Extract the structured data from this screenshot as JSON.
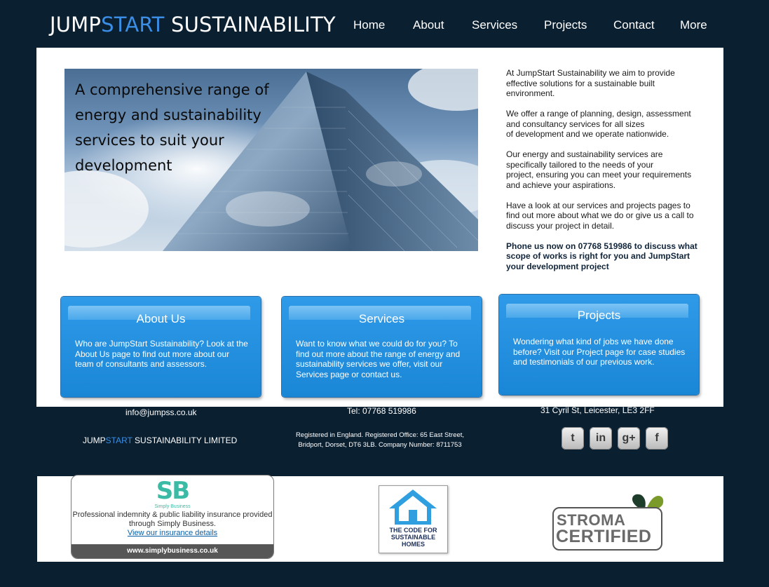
{
  "header": {
    "logo_part1": "JUMP",
    "logo_part2": "START",
    "logo_part3": " SUSTAINABILITY",
    "nav": [
      "Home",
      "About",
      "Services",
      "Projects",
      "Contact",
      "More"
    ]
  },
  "hero": {
    "headline": "A comprehensive range of energy and sustainability services to suit your development"
  },
  "intro": {
    "paragraphs": [
      "At JumpStart Sustainability we aim to provide\neffective solutions for a sustainable built\nenvironment.",
      "We offer a range of planning, design, assessment\nand consultancy services for all sizes\nof development and we operate nationwide.",
      "Our energy and sustainability services are\nspecifically tailored to the needs of your\nproject, ensuring you can meet your requirements\nand achieve your aspirations.",
      "Have a look at our services and projects pages to\nfind out more about what we do or give us a call to\ndiscuss your project in detail."
    ],
    "callout": "Phone us now on 07768 519986  to discuss what\nscope of works is right for you and JumpStart\nyour development project"
  },
  "cards": [
    {
      "title": "About Us",
      "body": "Who are JumpStart Sustainability? Look at the About Us page to find out more about our team of consultants and assessors."
    },
    {
      "title": "Services",
      "body": "Want to know what we could do for you? To find out more about the range of energy and sustainability services we offer, visit our Services page or contact us."
    },
    {
      "title": "Projects",
      "body": "Wondering what kind of jobs we have done before? Visit our Project page for case studies and testimonials of our previous work."
    }
  ],
  "footer": {
    "email": "info@jumpss.co.uk",
    "tel": "Tel: 07768 519986",
    "address": "31 Cyril St,  Leicester, LE3 2FF",
    "company_part1": "JUMP",
    "company_part2": "START",
    "company_part3": " SUSTAINABILITY LIMITED",
    "registered": "Registered in England. Registered Office: 65 East Street,\nBridport, Dorset, DT6 3LB. Company Number: 8711753",
    "social": [
      {
        "icon": "twitter-icon",
        "glyph": "t"
      },
      {
        "icon": "linkedin-icon",
        "glyph": "in"
      },
      {
        "icon": "google-plus-icon",
        "glyph": "g+"
      },
      {
        "icon": "facebook-icon",
        "glyph": "f"
      }
    ]
  },
  "badges": {
    "sb_logo": "SB",
    "sb_sub": "Simply Business",
    "sb_text": "Professional indemnity & public liability insurance provided through Simply Business.",
    "sb_link": "View our insurance details",
    "sb_url": "www.simplybusiness.co.uk",
    "code_homes": "THE CODE FOR\nSUSTAINABLE\nHOMES",
    "stroma_1": "STROMA",
    "stroma_2": "CERTIFIED"
  },
  "colors": {
    "background": "#0a1f30",
    "accent": "#3a8ee6",
    "card_blue": "#1a86d6"
  }
}
